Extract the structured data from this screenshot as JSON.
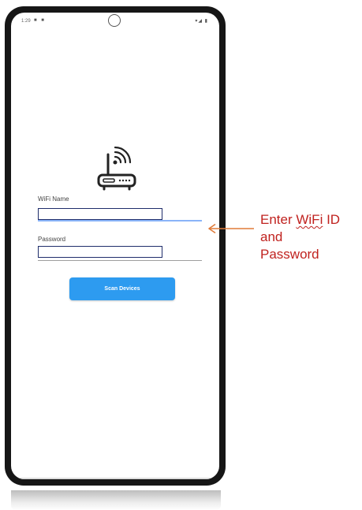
{
  "status_bar": {
    "time": "1:29",
    "left_icons": "■ ■",
    "right_icons": "▾◢ ▮"
  },
  "form": {
    "wifi_label": "WiFi Name",
    "wifi_value": "",
    "password_label": "Password",
    "password_value": ""
  },
  "scan_button": {
    "label": "Scan Devices"
  },
  "callout": {
    "line1_prefix": "Enter ",
    "line1_word": "WiFi",
    "line1_suffix": " ID",
    "line2": "and",
    "line3": "Password"
  },
  "colors": {
    "accent": "#2d9bf0",
    "annotation": "#c0221f",
    "arrow": "#e07b39",
    "field_border": "#1f2d6b"
  }
}
